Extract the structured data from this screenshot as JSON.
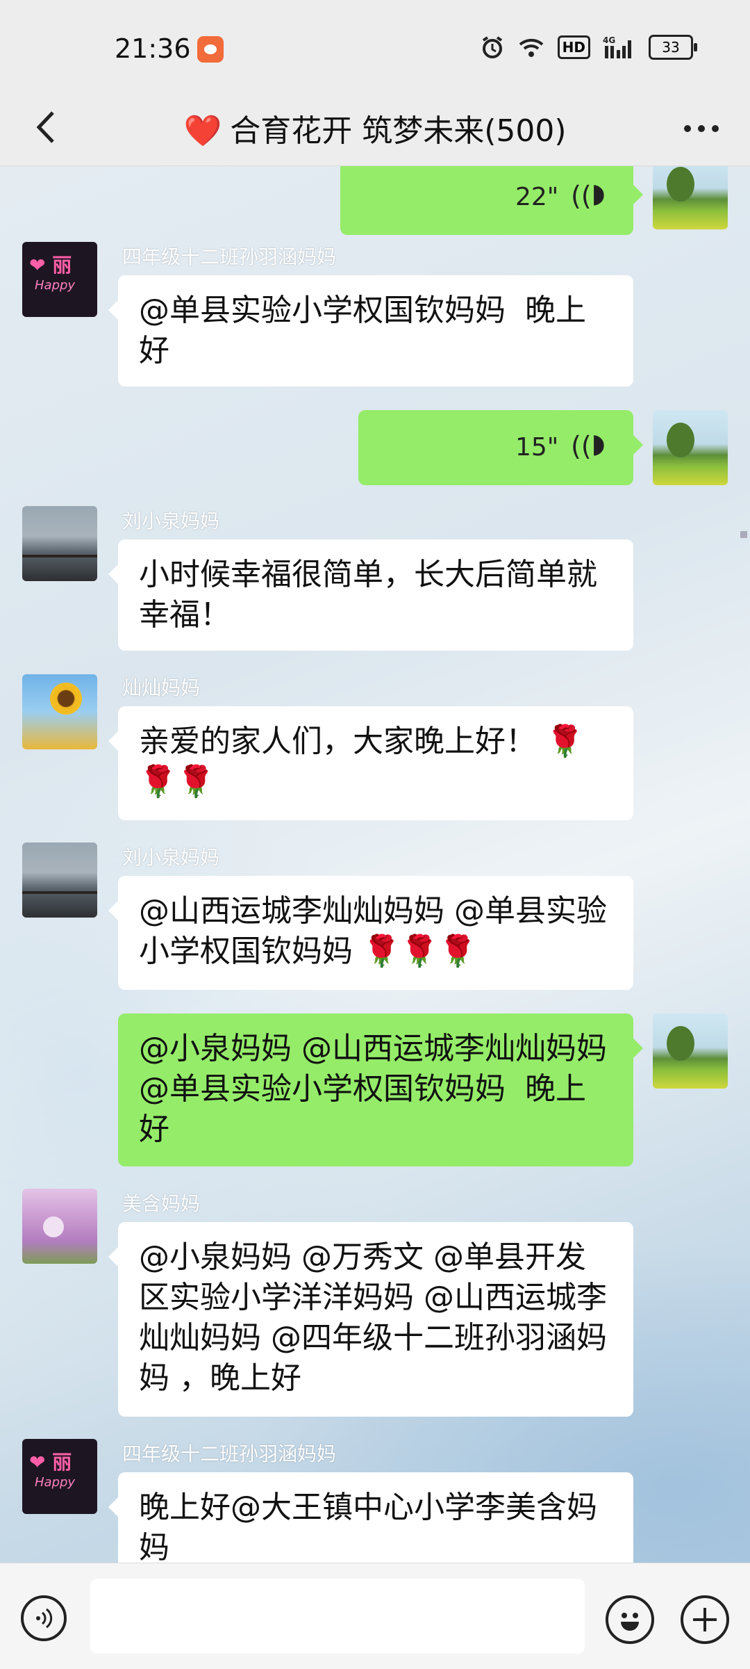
{
  "status_bar": {
    "time": "21:36",
    "network": "4G",
    "hd": "HD",
    "battery": "33"
  },
  "header": {
    "back_icon": "chevron-left-icon",
    "heart": "❤️",
    "title": "合育花开 筑梦未来(500)",
    "more_icon": "more-icon"
  },
  "messages": [
    {
      "type": "voice",
      "side": "right",
      "duration": "22\""
    },
    {
      "type": "text",
      "side": "left",
      "sender": "四年级十二班孙羽涵妈妈",
      "text": "@单县实验小学权国钦妈妈  晚上好"
    },
    {
      "type": "voice",
      "side": "right",
      "duration": "15\""
    },
    {
      "type": "text",
      "side": "left",
      "sender": "刘小泉妈妈",
      "text": "小时候幸福很简单，长大后简单就幸福！"
    },
    {
      "type": "text",
      "side": "left",
      "sender": "灿灿妈妈",
      "text": "亲爱的家人们，大家晚上好！ 🌹🌹🌹"
    },
    {
      "type": "text",
      "side": "left",
      "sender": "刘小泉妈妈",
      "text": "@山西运城李灿灿妈妈 @单县实验小学权国钦妈妈 🌹🌹🌹"
    },
    {
      "type": "text",
      "side": "right",
      "text": "@小泉妈妈 @山西运城李灿灿妈妈  @单县实验小学权国钦妈妈  晚上好"
    },
    {
      "type": "text",
      "side": "left",
      "sender": "美含妈妈",
      "text": "@小泉妈妈 @万秀文 @单县开发区实验小学洋洋妈妈 @山西运城李灿灿妈妈 @四年级十二班孙羽涵妈妈 ，晚上好"
    },
    {
      "type": "text",
      "side": "left",
      "sender": "四年级十二班孙羽涵妈妈",
      "text": "晚上好@大王镇中心小学李美含妈妈"
    }
  ],
  "avatar_text": {
    "neon_title": "丽",
    "neon_sub": "Happy"
  },
  "input_bar": {
    "voice_icon": "voice-icon",
    "emoji_icon": "emoji-icon",
    "plus_icon": "plus-icon",
    "placeholder": ""
  }
}
